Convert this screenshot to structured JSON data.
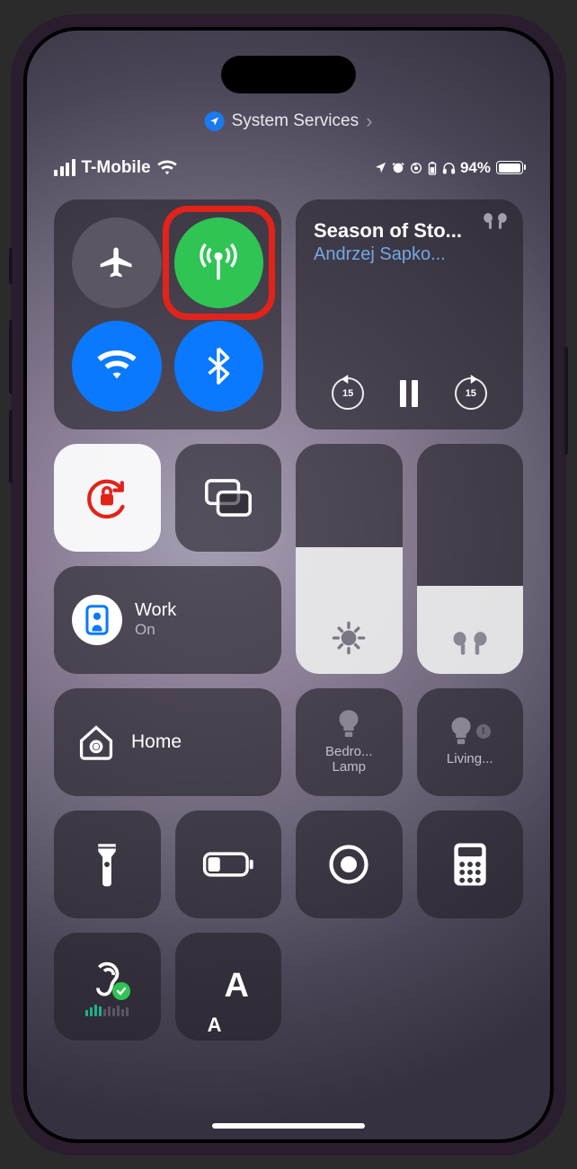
{
  "breadcrumb": {
    "label": "System Services"
  },
  "status": {
    "carrier": "T-Mobile",
    "battery_pct": "94%"
  },
  "connectivity": {
    "airplane": false,
    "cellular": true,
    "wifi": true,
    "bluetooth": true
  },
  "media": {
    "title": "Season of Sto...",
    "artist": "Andrzej Sapko...",
    "skip_seconds": "15",
    "playing": true
  },
  "orientation_lock": true,
  "focus": {
    "name": "Work",
    "state": "On"
  },
  "sliders": {
    "brightness_pct": 55,
    "volume_pct": 38
  },
  "home": {
    "label": "Home"
  },
  "homekit": [
    {
      "line1": "Bedro...",
      "line2": "Lamp",
      "info": false
    },
    {
      "line1": "Living...",
      "line2": "",
      "info": true
    }
  ],
  "text_size": {
    "label": "A"
  },
  "hearing": {
    "check_ok": true
  }
}
